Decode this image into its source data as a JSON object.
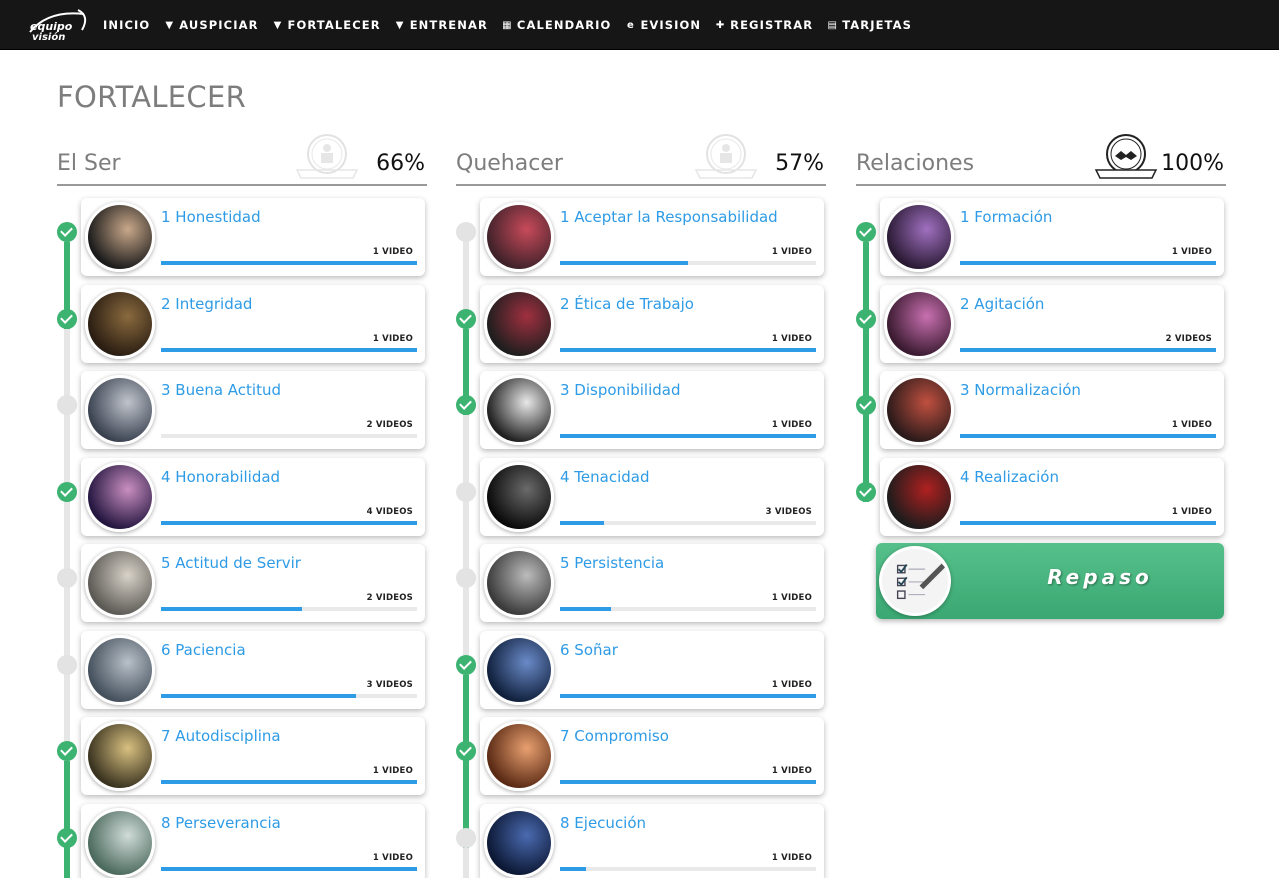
{
  "nav": {
    "logo_text_top": "equipo",
    "logo_text_bottom": "visión",
    "items": [
      {
        "label": "INICIO",
        "icon": "none"
      },
      {
        "label": "AUSPICIAR",
        "icon": "triangle-down-icon"
      },
      {
        "label": "FORTALECER",
        "icon": "triangle-down-icon"
      },
      {
        "label": "ENTRENAR",
        "icon": "triangle-down-icon"
      },
      {
        "label": "CALENDARIO",
        "icon": "calendar-icon"
      },
      {
        "label": "EVISION",
        "icon": "e-icon"
      },
      {
        "label": "REGISTRAR",
        "icon": "user-plus-icon"
      },
      {
        "label": "TARJETAS",
        "icon": "id-card-icon"
      }
    ]
  },
  "page_title": "FORTALECER",
  "columns": [
    {
      "title": "El Ser",
      "percent": "66%",
      "items": [
        {
          "label": "1 Honestidad",
          "videos": "1 VIDEO",
          "progress": 1.0,
          "done": true,
          "colors": [
            "#1b1b1b",
            "#c9a88a"
          ]
        },
        {
          "label": "2 Integridad",
          "videos": "1 VIDEO",
          "progress": 1.0,
          "done": true,
          "colors": [
            "#2a1d12",
            "#8a6a3e"
          ]
        },
        {
          "label": "3 Buena Actitud",
          "videos": "2 VIDEOS",
          "progress": 0.0,
          "done": false,
          "colors": [
            "#3a4250",
            "#c0c4cc"
          ]
        },
        {
          "label": "4 Honorabilidad",
          "videos": "4 VIDEOS",
          "progress": 1.0,
          "done": true,
          "colors": [
            "#241640",
            "#c98fc0"
          ]
        },
        {
          "label": "5 Actitud de Servir",
          "videos": "2 VIDEOS",
          "progress": 0.55,
          "done": false,
          "colors": [
            "#5c5a55",
            "#d8d2c8"
          ]
        },
        {
          "label": "6 Paciencia",
          "videos": "3 VIDEOS",
          "progress": 0.76,
          "done": false,
          "colors": [
            "#44505c",
            "#b8c0c8"
          ]
        },
        {
          "label": "7 Autodisciplina",
          "videos": "1 VIDEO",
          "progress": 1.0,
          "done": true,
          "colors": [
            "#3a3320",
            "#d8c080"
          ]
        },
        {
          "label": "8 Perseverancia",
          "videos": "1 VIDEO",
          "progress": 1.0,
          "done": true,
          "colors": [
            "#4c6a5e",
            "#d0dcd8"
          ]
        }
      ]
    },
    {
      "title": "Quehacer",
      "percent": "57%",
      "items": [
        {
          "label": "1 Aceptar la Responsabilidad",
          "videos": "1 VIDEO",
          "progress": 0.5,
          "done": false,
          "colors": [
            "#40222a",
            "#c84a5a"
          ]
        },
        {
          "label": "2 Ética de Trabajo",
          "videos": "1 VIDEO",
          "progress": 1.0,
          "done": true,
          "colors": [
            "#1e1e1e",
            "#a03040"
          ]
        },
        {
          "label": "3 Disponibilidad",
          "videos": "1 VIDEO",
          "progress": 1.0,
          "done": true,
          "colors": [
            "#202020",
            "#e8e8e8"
          ]
        },
        {
          "label": "4 Tenacidad",
          "videos": "3 VIDEOS",
          "progress": 0.17,
          "done": false,
          "colors": [
            "#0a0a0a",
            "#6a6a6a"
          ]
        },
        {
          "label": "5 Persistencia",
          "videos": "1 VIDEO",
          "progress": 0.2,
          "done": false,
          "colors": [
            "#3a3a3a",
            "#bcbcbc"
          ]
        },
        {
          "label": "6 Soñar",
          "videos": "1 VIDEO",
          "progress": 1.0,
          "done": true,
          "colors": [
            "#10203c",
            "#6a8ac8"
          ]
        },
        {
          "label": "7 Compromiso",
          "videos": "1 VIDEO",
          "progress": 1.0,
          "done": true,
          "colors": [
            "#5a2a14",
            "#e8a070"
          ]
        },
        {
          "label": "8 Ejecución",
          "videos": "1 VIDEO",
          "progress": 0.1,
          "done": false,
          "colors": [
            "#0c1834",
            "#4a6ab0"
          ]
        }
      ]
    },
    {
      "title": "Relaciones",
      "percent": "100%",
      "items": [
        {
          "label": "1 Formación",
          "videos": "1 VIDEO",
          "progress": 1.0,
          "done": true,
          "colors": [
            "#2a1a34",
            "#a070c0"
          ]
        },
        {
          "label": "2 Agitación",
          "videos": "2 VIDEOS",
          "progress": 1.0,
          "done": true,
          "colors": [
            "#3a1a30",
            "#c870b0"
          ]
        },
        {
          "label": "3 Normalización",
          "videos": "1 VIDEO",
          "progress": 1.0,
          "done": true,
          "colors": [
            "#2a1a1a",
            "#c05040"
          ]
        },
        {
          "label": "4 Realización",
          "videos": "1 VIDEO",
          "progress": 1.0,
          "done": true,
          "colors": [
            "#1c1c1c",
            "#b02020"
          ]
        }
      ],
      "repaso": "Repaso"
    }
  ],
  "colors": {
    "nav_bg": "#161616",
    "accent_blue": "#2e9be6",
    "done_green": "#3cb371",
    "repaso_green": "#48b47f"
  }
}
